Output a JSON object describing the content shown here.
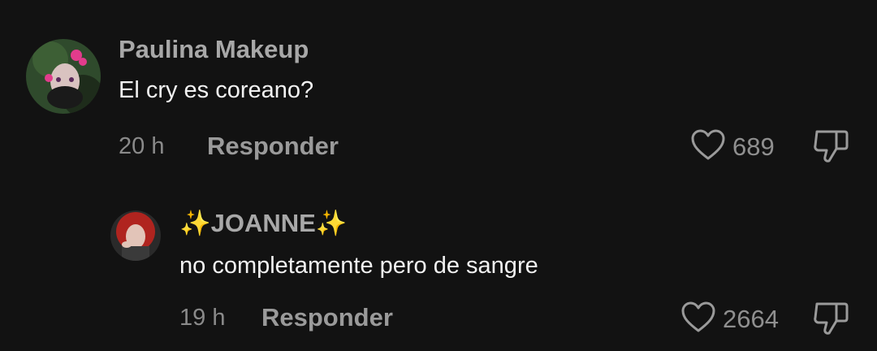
{
  "comments": [
    {
      "author": "Paulina Makeup",
      "text": "El cry es coreano?",
      "time": "20 h",
      "reply_label": "Responder",
      "likes": "689"
    },
    {
      "author_prefix": "✨",
      "author": "JOANNE",
      "author_suffix": "✨",
      "text": "no completamente pero de sangre",
      "time": "19 h",
      "reply_label": "Responder",
      "likes": "2664"
    }
  ],
  "colors": {
    "background": "#121212",
    "author": "#a8a8a8",
    "secondary": "#8a8a8a"
  },
  "icons": [
    "heart-outline-icon",
    "thumbs-down-icon"
  ]
}
